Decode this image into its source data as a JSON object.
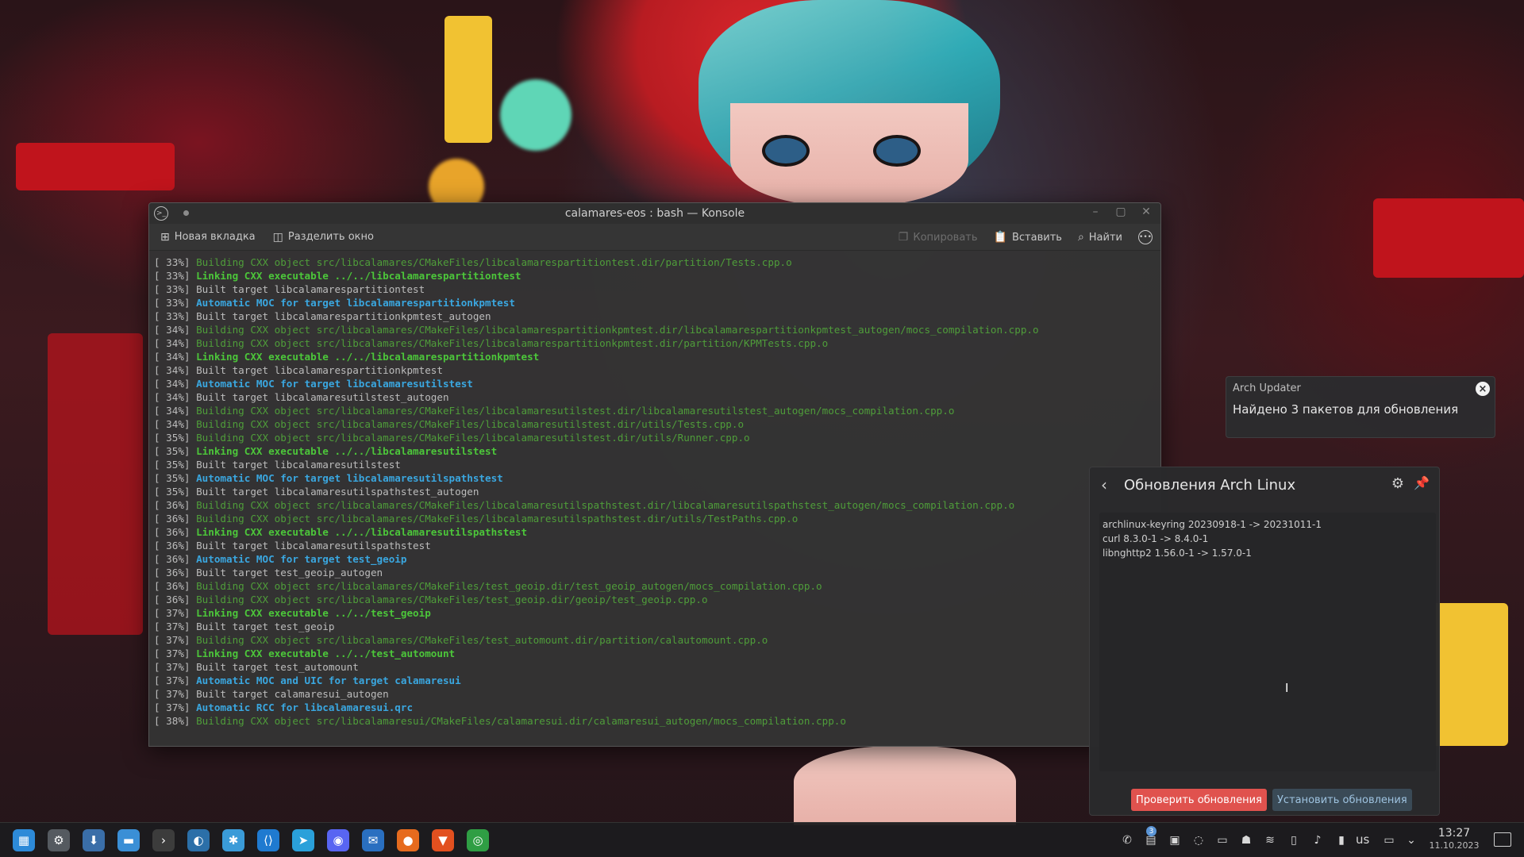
{
  "wallpaper": {
    "name": "wallpaper"
  },
  "konsole": {
    "title": "calamares-eos : bash — Konsole",
    "toolbar": {
      "new_tab": "Новая вкладка",
      "split_view": "Разделить окно",
      "copy": "Копировать",
      "paste": "Вставить",
      "find": "Найти"
    },
    "icons": {
      "app": "terminal-icon",
      "new_tab": "new-tab-icon",
      "split": "split-view-icon",
      "copy": "copy-icon",
      "paste": "paste-icon",
      "find": "search-icon",
      "more": "more-icon"
    },
    "colors": {
      "building": "#4f9d3a",
      "linking": "#4cc63a",
      "moc": "#3aa7e0",
      "built": "#bcbcbc"
    },
    "lines": [
      {
        "pct": "[ 33%]",
        "type": "build",
        "text": "Building CXX object src/libcalamares/CMakeFiles/libcalamarespartitiontest.dir/partition/Tests.cpp.o"
      },
      {
        "pct": "[ 33%]",
        "type": "link",
        "text": "Linking CXX executable ../../libcalamarespartitiontest"
      },
      {
        "pct": "[ 33%]",
        "type": "plain",
        "text": "Built target libcalamarespartitiontest"
      },
      {
        "pct": "[ 33%]",
        "type": "moc",
        "text": "Automatic MOC for target libcalamarespartitionkpmtest"
      },
      {
        "pct": "[ 33%]",
        "type": "plain",
        "text": "Built target libcalamarespartitionkpmtest_autogen"
      },
      {
        "pct": "[ 34%]",
        "type": "build",
        "text": "Building CXX object src/libcalamares/CMakeFiles/libcalamarespartitionkpmtest.dir/libcalamarespartitionkpmtest_autogen/mocs_compilation.cpp.o"
      },
      {
        "pct": "[ 34%]",
        "type": "build",
        "text": "Building CXX object src/libcalamares/CMakeFiles/libcalamarespartitionkpmtest.dir/partition/KPMTests.cpp.o"
      },
      {
        "pct": "[ 34%]",
        "type": "link",
        "text": "Linking CXX executable ../../libcalamarespartitionkpmtest"
      },
      {
        "pct": "[ 34%]",
        "type": "plain",
        "text": "Built target libcalamarespartitionkpmtest"
      },
      {
        "pct": "[ 34%]",
        "type": "moc",
        "text": "Automatic MOC for target libcalamaresutilstest"
      },
      {
        "pct": "[ 34%]",
        "type": "plain",
        "text": "Built target libcalamaresutilstest_autogen"
      },
      {
        "pct": "[ 34%]",
        "type": "build",
        "text": "Building CXX object src/libcalamares/CMakeFiles/libcalamaresutilstest.dir/libcalamaresutilstest_autogen/mocs_compilation.cpp.o"
      },
      {
        "pct": "[ 34%]",
        "type": "build",
        "text": "Building CXX object src/libcalamares/CMakeFiles/libcalamaresutilstest.dir/utils/Tests.cpp.o"
      },
      {
        "pct": "[ 35%]",
        "type": "build",
        "text": "Building CXX object src/libcalamares/CMakeFiles/libcalamaresutilstest.dir/utils/Runner.cpp.o"
      },
      {
        "pct": "[ 35%]",
        "type": "link",
        "text": "Linking CXX executable ../../libcalamaresutilstest"
      },
      {
        "pct": "[ 35%]",
        "type": "plain",
        "text": "Built target libcalamaresutilstest"
      },
      {
        "pct": "[ 35%]",
        "type": "moc",
        "text": "Automatic MOC for target libcalamaresutilspathstest"
      },
      {
        "pct": "[ 35%]",
        "type": "plain",
        "text": "Built target libcalamaresutilspathstest_autogen"
      },
      {
        "pct": "[ 36%]",
        "type": "build",
        "text": "Building CXX object src/libcalamares/CMakeFiles/libcalamaresutilspathstest.dir/libcalamaresutilspathstest_autogen/mocs_compilation.cpp.o"
      },
      {
        "pct": "[ 36%]",
        "type": "build",
        "text": "Building CXX object src/libcalamares/CMakeFiles/libcalamaresutilspathstest.dir/utils/TestPaths.cpp.o"
      },
      {
        "pct": "[ 36%]",
        "type": "link",
        "text": "Linking CXX executable ../../libcalamaresutilspathstest"
      },
      {
        "pct": "[ 36%]",
        "type": "plain",
        "text": "Built target libcalamaresutilspathstest"
      },
      {
        "pct": "[ 36%]",
        "type": "moc",
        "text": "Automatic MOC for target test_geoip"
      },
      {
        "pct": "[ 36%]",
        "type": "plain",
        "text": "Built target test_geoip_autogen"
      },
      {
        "pct": "[ 36%]",
        "type": "build",
        "text": "Building CXX object src/libcalamares/CMakeFiles/test_geoip.dir/test_geoip_autogen/mocs_compilation.cpp.o"
      },
      {
        "pct": "[ 36%]",
        "type": "build",
        "text": "Building CXX object src/libcalamares/CMakeFiles/test_geoip.dir/geoip/test_geoip.cpp.o"
      },
      {
        "pct": "[ 37%]",
        "type": "link",
        "text": "Linking CXX executable ../../test_geoip"
      },
      {
        "pct": "[ 37%]",
        "type": "plain",
        "text": "Built target test_geoip"
      },
      {
        "pct": "[ 37%]",
        "type": "build",
        "text": "Building CXX object src/libcalamares/CMakeFiles/test_automount.dir/partition/calautomount.cpp.o"
      },
      {
        "pct": "[ 37%]",
        "type": "link",
        "text": "Linking CXX executable ../../test_automount"
      },
      {
        "pct": "[ 37%]",
        "type": "plain",
        "text": "Built target test_automount"
      },
      {
        "pct": "[ 37%]",
        "type": "moc",
        "text": "Automatic MOC and UIC for target calamaresui"
      },
      {
        "pct": "[ 37%]",
        "type": "plain",
        "text": "Built target calamaresui_autogen"
      },
      {
        "pct": "[ 37%]",
        "type": "moc",
        "text": "Automatic RCC for libcalamaresui.qrc"
      },
      {
        "pct": "[ 38%]",
        "type": "build",
        "text": "Building CXX object src/libcalamaresui/CMakeFiles/calamaresui.dir/calamaresui_autogen/mocs_compilation.cpp.o"
      }
    ]
  },
  "notification": {
    "app": "Arch Updater",
    "body": "Найдено 3 пакетов для обновления",
    "close_icon": "close-icon"
  },
  "updates": {
    "title": "Обновления Arch Linux",
    "back_icon": "back-arrow-icon",
    "settings_icon": "gear-icon",
    "pin_icon": "pin-icon",
    "packages": [
      "archlinux-keyring 20230918-1 -> 20231011-1",
      "curl 8.3.0-1 -> 8.4.0-1",
      "libnghttp2 1.56.0-1 -> 1.57.0-1"
    ],
    "check_button": "Проверить обновления",
    "install_button": "Установить обновления",
    "colors": {
      "check_bg": "#e0524e",
      "install_bg": "#3a4a56",
      "install_text": "#9ec3e0"
    }
  },
  "taskbar": {
    "apps": [
      {
        "name": "application-launcher-icon",
        "glyph": "▦",
        "color": "#2d8ad8"
      },
      {
        "name": "system-settings-icon",
        "glyph": "⚙",
        "color": "#555a60"
      },
      {
        "name": "software-store-icon",
        "glyph": "⬇",
        "color": "#3a6ea8"
      },
      {
        "name": "file-manager-icon",
        "glyph": "▬",
        "color": "#3a8fd6"
      },
      {
        "name": "terminal-icon",
        "glyph": "›",
        "color": "#3c3c3c"
      },
      {
        "name": "browser-edge-icon",
        "glyph": "◐",
        "color": "#2b6fa8"
      },
      {
        "name": "kde-connect-icon",
        "glyph": "✱",
        "color": "#3a9bd8"
      },
      {
        "name": "vscode-icon",
        "glyph": "⟨⟩",
        "color": "#1f7ad0"
      },
      {
        "name": "telegram-icon",
        "glyph": "➤",
        "color": "#2aa0da"
      },
      {
        "name": "discord-icon",
        "glyph": "◉",
        "color": "#5865f2"
      },
      {
        "name": "thunderbird-icon",
        "glyph": "✉",
        "color": "#2a6fc0"
      },
      {
        "name": "firefox-icon",
        "glyph": "●",
        "color": "#e66b1e"
      },
      {
        "name": "brave-icon",
        "glyph": "▼",
        "color": "#e2501f"
      },
      {
        "name": "chrome-icon",
        "glyph": "◎",
        "color": "#2f9e44"
      }
    ],
    "tray": [
      {
        "name": "kde-connect-tray-icon",
        "glyph": "✆"
      },
      {
        "name": "updates-tray-icon",
        "glyph": "▤"
      },
      {
        "name": "screenshot-tray-icon",
        "glyph": "▣"
      },
      {
        "name": "vpn-tray-icon",
        "glyph": "◌"
      },
      {
        "name": "display-tray-icon",
        "glyph": "▭"
      },
      {
        "name": "ghost-tray-icon",
        "glyph": "☗"
      },
      {
        "name": "network-tray-icon",
        "glyph": "≋"
      },
      {
        "name": "clipboard-tray-icon",
        "glyph": "▯"
      },
      {
        "name": "volume-tray-icon",
        "glyph": "♪"
      },
      {
        "name": "battery-tray-icon",
        "glyph": "▮"
      }
    ],
    "badge": "3",
    "language": "us",
    "time": "13:27",
    "date": "11.10.2023",
    "expand_icon": "chevron-down-icon",
    "monitor_icon": "monitor-tray-icon",
    "desktop_icon": "show-desktop-icon"
  }
}
